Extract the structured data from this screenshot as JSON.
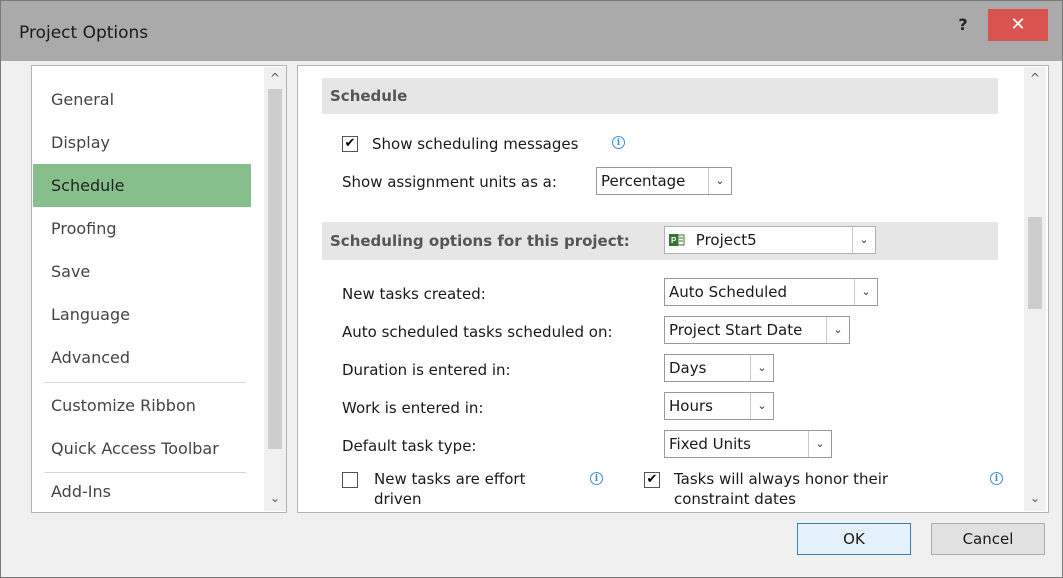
{
  "window": {
    "title": "Project Options",
    "help_label": "?",
    "close_label": "✕"
  },
  "nav": {
    "items": [
      {
        "label": "General"
      },
      {
        "label": "Display"
      },
      {
        "label": "Schedule"
      },
      {
        "label": "Proofing"
      },
      {
        "label": "Save"
      },
      {
        "label": "Language"
      },
      {
        "label": "Advanced"
      },
      {
        "label": "Customize Ribbon"
      },
      {
        "label": "Quick Access Toolbar"
      },
      {
        "label": "Add-Ins"
      }
    ],
    "selected": "Schedule"
  },
  "schedule": {
    "header": "Schedule",
    "show_messages_label": "Show scheduling messages",
    "show_messages_checked": true,
    "assignment_units_label": "Show assignment units as a:",
    "assignment_units_value": "Percentage"
  },
  "project_options": {
    "header_label": "Scheduling options for this project:",
    "project_name": "Project5",
    "rows": [
      {
        "label": "New tasks created:",
        "value": "Auto Scheduled"
      },
      {
        "label": "Auto scheduled tasks scheduled on:",
        "value": "Project Start Date"
      },
      {
        "label": "Duration is entered in:",
        "value": "Days"
      },
      {
        "label": "Work is entered in:",
        "value": "Hours"
      },
      {
        "label": "Default task type:",
        "value": "Fixed Units"
      }
    ],
    "effort_driven_line1": "New tasks are effort",
    "effort_driven_line2": "driven",
    "effort_driven_checked": false,
    "honor_constraints_line1": "Tasks will always honor their",
    "honor_constraints_line2": "constraint dates",
    "honor_constraints_checked": true
  },
  "icons": {
    "check": "✔",
    "chevron_down": "⌄",
    "scroll_up": "^",
    "scroll_down": "⌄",
    "info": "i"
  },
  "buttons": {
    "ok": "OK",
    "cancel": "Cancel"
  },
  "colors": {
    "selected_nav": "#86bf8b",
    "close_button": "#d9534f",
    "info_blue": "#3c8cdc"
  }
}
